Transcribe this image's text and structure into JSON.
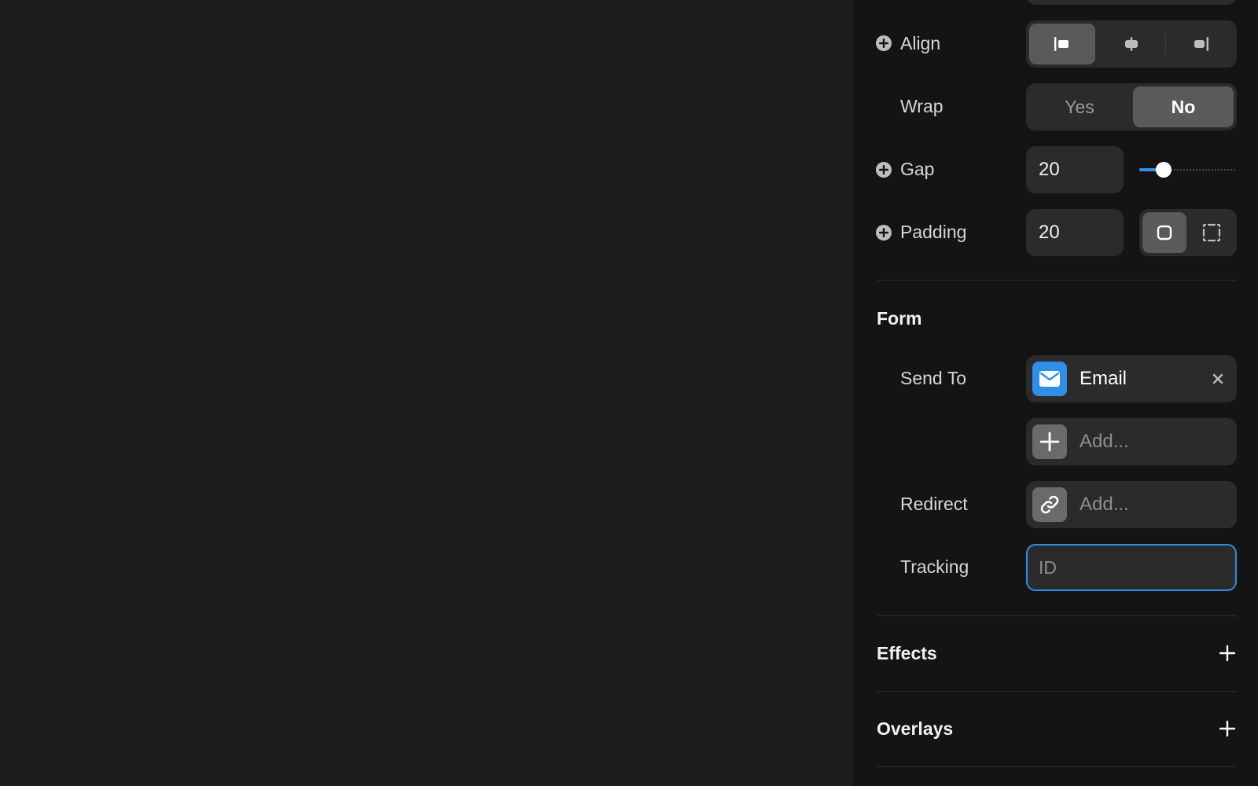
{
  "layout_props": {
    "align": {
      "label": "Align",
      "options": [
        "align-left",
        "align-center",
        "align-right"
      ],
      "selected": "align-left"
    },
    "wrap": {
      "label": "Wrap",
      "options": [
        "Yes",
        "No"
      ],
      "selected": "No"
    },
    "gap": {
      "label": "Gap",
      "value": "20",
      "slider_fraction": 0.25
    },
    "padding": {
      "label": "Padding",
      "value": "20",
      "modes": [
        "uniform",
        "individual"
      ],
      "selected": "uniform"
    }
  },
  "form": {
    "title": "Form",
    "send_to_label": "Send To",
    "send_to_item": "Email",
    "add_placeholder": "Add...",
    "redirect_label": "Redirect",
    "redirect_placeholder": "Add...",
    "tracking_label": "Tracking",
    "tracking_placeholder": "ID"
  },
  "effects": {
    "title": "Effects"
  },
  "overlays": {
    "title": "Overlays"
  },
  "colors": {
    "accent": "#2f8fe8",
    "email_tile": "#2f8fe8",
    "panel_bg": "#141414",
    "canvas_bg": "#1d1d1d"
  }
}
